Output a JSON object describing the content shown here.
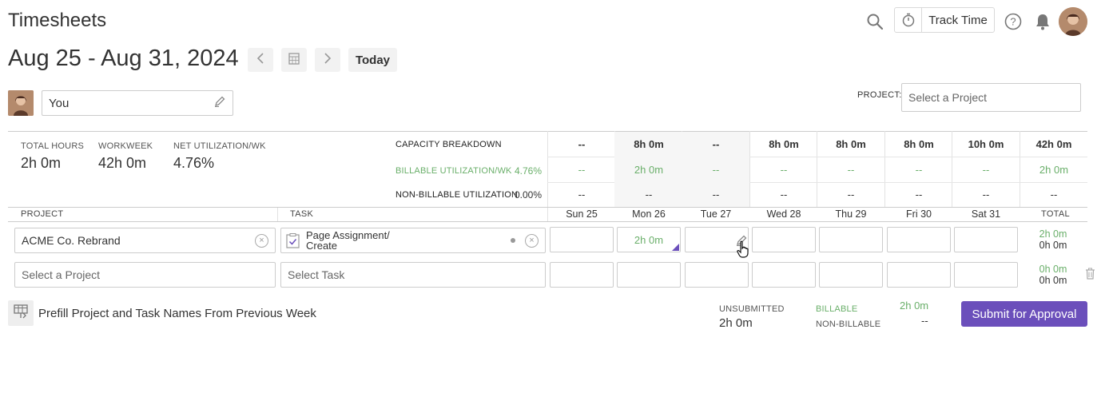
{
  "header": {
    "title": "Timesheets",
    "track_time_label": "Track Time"
  },
  "toolbar": {
    "date_range": "Aug 25 - Aug 31, 2024",
    "today_label": "Today"
  },
  "user": {
    "name": "You"
  },
  "project_filter": {
    "label": "PROJECT:",
    "placeholder": "Select a Project"
  },
  "stats": {
    "total_hours_label": "TOTAL HOURS",
    "total_hours": "2h 0m",
    "workweek_label": "WORKWEEK",
    "workweek": "42h 0m",
    "net_util_label": "NET UTILIZATION/WK",
    "net_util": "4.76%"
  },
  "capacity": {
    "breakdown_label": "CAPACITY BREAKDOWN",
    "billable_label": "BILLABLE UTILIZATION/WK",
    "billable_pct": "4.76%",
    "nonbillable_label": "NON-BILLABLE UTILIZATION",
    "nonbillable_pct": "0.00%",
    "capacity_row": [
      "--",
      "8h 0m",
      "--",
      "8h 0m",
      "8h 0m",
      "8h 0m",
      "10h 0m",
      "42h 0m"
    ],
    "billable_row": [
      "--",
      "2h 0m",
      "--",
      "--",
      "--",
      "--",
      "--",
      "2h 0m"
    ],
    "nonbillable_row": [
      "--",
      "--",
      "--",
      "--",
      "--",
      "--",
      "--",
      "--"
    ]
  },
  "columns": {
    "project": "PROJECT",
    "task": "TASK",
    "days": [
      "Sun 25",
      "Mon 26",
      "Tue 27",
      "Wed 28",
      "Thu 29",
      "Fri 30",
      "Sat 31"
    ],
    "total": "TOTAL"
  },
  "rows": [
    {
      "project": "ACME Co. Rebrand",
      "task_line1": "Page Assignment/",
      "task_line2": "Create",
      "cells": [
        "",
        "2h 0m",
        "",
        "",
        "",
        "",
        ""
      ],
      "total_billable": "2h 0m",
      "total_nonbillable": "0h 0m"
    },
    {
      "project_placeholder": "Select a Project",
      "task_placeholder": "Select Task",
      "cells": [
        "",
        "",
        "",
        "",
        "",
        "",
        ""
      ],
      "total_billable": "0h 0m",
      "total_nonbillable": "0h 0m"
    }
  ],
  "footer": {
    "prefill_label": "Prefill Project and Task Names From Previous Week",
    "unsubmitted_label": "UNSUBMITTED",
    "unsubmitted_value": "2h 0m",
    "billable_label": "BILLABLE",
    "billable_value": "2h 0m",
    "nonbillable_label": "NON-BILLABLE",
    "nonbillable_value": "--",
    "submit_label": "Submit for Approval"
  },
  "colors": {
    "accent": "#6b4fbb",
    "billable_green": "#6aaf6a"
  }
}
